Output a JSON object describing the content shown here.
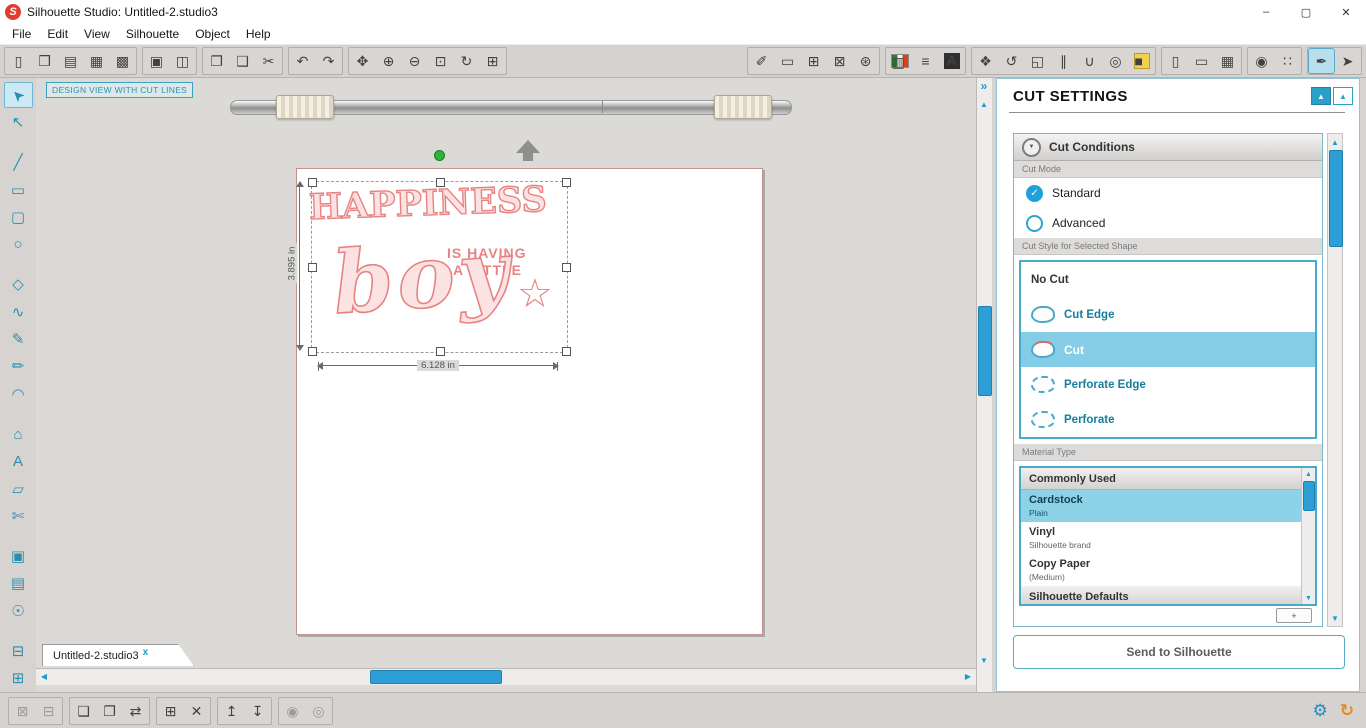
{
  "window": {
    "title": "Silhouette Studio: Untitled-2.studio3"
  },
  "colors": {
    "accent_teal": "#2aa0c8",
    "selection_blue": "#85cde7",
    "material_selected": "#8ed2e8",
    "scroll_thumb": "#2d9fd6",
    "design_pink": "#e88383",
    "logo_red": "#e23c30"
  },
  "icons": {
    "logo": "S",
    "minimize": "–",
    "maximize": "▢",
    "close": "✕",
    "up": "▲",
    "down": "▼",
    "left": "◀",
    "right": "▶",
    "collapse": "»",
    "check": "✓",
    "gear": "⚙",
    "sync": "↻",
    "plus": "+"
  },
  "menu": {
    "items": [
      {
        "name": "menu-file",
        "label": "File"
      },
      {
        "name": "menu-edit",
        "label": "Edit"
      },
      {
        "name": "menu-view",
        "label": "View"
      },
      {
        "name": "menu-silhouette",
        "label": "Silhouette"
      },
      {
        "name": "menu-object",
        "label": "Object"
      },
      {
        "name": "menu-help",
        "label": "Help"
      }
    ]
  },
  "toolbar": {
    "file_group": [
      {
        "name": "new-document-button",
        "icon": "new-document-icon",
        "glyph": "▯"
      },
      {
        "name": "open-document-button",
        "icon": "open-folder-icon",
        "glyph": "❒"
      },
      {
        "name": "open-recent-button",
        "icon": "recent-files-icon",
        "glyph": "▤"
      },
      {
        "name": "save-button",
        "icon": "save-icon",
        "glyph": "▦"
      },
      {
        "name": "save-as-button",
        "icon": "save-as-icon",
        "glyph": "▩"
      }
    ],
    "print_group": [
      {
        "name": "print-button",
        "icon": "printer-icon",
        "glyph": "▣"
      },
      {
        "name": "print-setup-button",
        "icon": "printer-setup-icon",
        "glyph": "◫"
      }
    ],
    "clipboard_group": [
      {
        "name": "copy-button",
        "icon": "copy-icon",
        "glyph": "❐"
      },
      {
        "name": "paste-button",
        "icon": "paste-icon",
        "glyph": "❑"
      },
      {
        "name": "cut-button",
        "icon": "scissors-icon",
        "glyph": "✂"
      }
    ],
    "undo_group": [
      {
        "name": "undo-button",
        "icon": "undo-icon",
        "glyph": "↶"
      },
      {
        "name": "redo-button",
        "icon": "redo-icon",
        "glyph": "↷"
      }
    ],
    "view_group": [
      {
        "name": "pan-button",
        "icon": "pan-icon",
        "glyph": "✥"
      },
      {
        "name": "zoom-in-button",
        "icon": "zoom-in-icon",
        "glyph": "⊕"
      },
      {
        "name": "zoom-out-button",
        "icon": "zoom-out-icon",
        "glyph": "⊖"
      },
      {
        "name": "zoom-selection-button",
        "icon": "zoom-selection-icon",
        "glyph": "⊡"
      },
      {
        "name": "zoom-reset-button",
        "icon": "zoom-reset-icon",
        "glyph": "↻"
      },
      {
        "name": "fit-to-page-button",
        "icon": "fit-to-page-icon",
        "glyph": "⊞"
      }
    ],
    "document_group": [
      {
        "name": "pixscan-button",
        "icon": "pixscan-icon",
        "glyph": "✐"
      },
      {
        "name": "page-settings-button",
        "icon": "page-settings-icon",
        "glyph": "▭"
      },
      {
        "name": "grid-settings-button",
        "icon": "grid-settings-icon",
        "glyph": "⊞"
      },
      {
        "name": "registration-marks-button",
        "icon": "registration-marks-icon",
        "glyph": "⊠"
      },
      {
        "name": "pierce-options-button",
        "icon": "pierce-options-icon",
        "glyph": "⊛"
      }
    ],
    "style_group": [
      {
        "name": "fill-color-button",
        "icon": "fill-color-icon",
        "glyph": "▥"
      },
      {
        "name": "line-style-button",
        "icon": "line-style-icon",
        "glyph": "≡"
      },
      {
        "name": "text-style-button",
        "icon": "text-style-icon",
        "glyph": "A"
      }
    ],
    "object_group": [
      {
        "name": "replicate-button",
        "icon": "replicate-icon",
        "glyph": "❖"
      },
      {
        "name": "rotate-options-button",
        "icon": "rotate-options-icon",
        "glyph": "↺"
      },
      {
        "name": "scale-options-button",
        "icon": "scale-options-icon",
        "glyph": "◱"
      },
      {
        "name": "align-options-button",
        "icon": "align-options-icon",
        "glyph": "∥"
      },
      {
        "name": "weld-options-button",
        "icon": "weld-options-icon",
        "glyph": "∪"
      },
      {
        "name": "offset-options-button",
        "icon": "offset-options-icon",
        "glyph": "◎"
      },
      {
        "name": "trace-options-button",
        "icon": "trace-options-icon",
        "glyph": "■"
      }
    ],
    "device_group": [
      {
        "name": "mobile-devices-button",
        "icon": "mobile-device-icon",
        "glyph": "▯"
      },
      {
        "name": "tablet-devices-button",
        "icon": "tablet-device-icon",
        "glyph": "▭"
      },
      {
        "name": "library-view-button",
        "icon": "library-grid-icon",
        "glyph": "▦"
      }
    ],
    "preview_group": [
      {
        "name": "camera-preview-button",
        "icon": "camera-preview-icon",
        "glyph": "◉"
      },
      {
        "name": "pattern-view-button",
        "icon": "pattern-view-icon",
        "glyph": "∷"
      }
    ],
    "panel_group": [
      {
        "name": "cut-settings-button",
        "icon": "cut-settings-icon",
        "glyph": "✒",
        "state": "active"
      },
      {
        "name": "send-to-silhouette-button",
        "icon": "send-to-silhouette-icon",
        "glyph": "➤"
      }
    ]
  },
  "tools": {
    "items": [
      {
        "name": "select-tool",
        "icon": "select-tool-icon",
        "glyph": "➤",
        "state": "active"
      },
      {
        "name": "point-editing-tool",
        "icon": "point-editing-icon",
        "glyph": "↖"
      },
      {
        "gap": true
      },
      {
        "name": "line-tool",
        "icon": "line-tool-icon",
        "glyph": "╱"
      },
      {
        "name": "rectangle-tool",
        "icon": "rectangle-tool-icon",
        "glyph": "▭"
      },
      {
        "name": "rounded-rectangle-tool",
        "icon": "rounded-rectangle-icon",
        "glyph": "▢"
      },
      {
        "name": "ellipse-tool",
        "icon": "ellipse-tool-icon",
        "glyph": "○"
      },
      {
        "gap": true
      },
      {
        "name": "polygon-tool",
        "icon": "polygon-tool-icon",
        "glyph": "◇"
      },
      {
        "name": "curve-tool",
        "icon": "curve-tool-icon",
        "glyph": "∿"
      },
      {
        "name": "freehand-tool",
        "icon": "freehand-tool-icon",
        "glyph": "✎"
      },
      {
        "name": "smooth-freehand-tool",
        "icon": "smooth-freehand-icon",
        "glyph": "✏"
      },
      {
        "name": "arc-tool",
        "icon": "arc-tool-icon",
        "glyph": "◠"
      },
      {
        "gap": true
      },
      {
        "name": "regular-polygon-tool",
        "icon": "regular-polygon-icon",
        "glyph": "⌂"
      },
      {
        "name": "text-tool",
        "icon": "text-tool-icon",
        "glyph": "A"
      },
      {
        "name": "eraser-tool",
        "icon": "eraser-tool-icon",
        "glyph": "▱"
      },
      {
        "name": "knife-tool",
        "icon": "knife-tool-icon",
        "glyph": "✄"
      },
      {
        "gap": true
      },
      {
        "name": "page-setup-panel-button",
        "icon": "page-setup-panel-icon",
        "glyph": "▣"
      },
      {
        "name": "sketch-panel-button",
        "icon": "sketch-panel-icon",
        "glyph": "▤"
      },
      {
        "name": "design-store-button",
        "icon": "design-store-icon",
        "glyph": "☉"
      },
      {
        "gap": true
      },
      {
        "name": "layers-panel-button",
        "icon": "layers-panel-icon",
        "glyph": "⊟"
      },
      {
        "name": "library-panel-button",
        "icon": "library-panel-icon",
        "glyph": "⊞"
      }
    ]
  },
  "bottom": {
    "transform_group": [
      {
        "name": "transform-options-button",
        "icon": "transform-options-icon",
        "glyph": "⊠",
        "state": "disabled"
      },
      {
        "name": "resize-options-button",
        "icon": "resize-options-icon",
        "glyph": "⊟",
        "state": "disabled"
      }
    ],
    "duplicate_group": [
      {
        "name": "copy-instance-button",
        "icon": "copy-instance-icon",
        "glyph": "❏"
      },
      {
        "name": "duplicate-button",
        "icon": "duplicate-icon",
        "glyph": "❐"
      },
      {
        "name": "mirror-button",
        "icon": "mirror-icon",
        "glyph": "⇄"
      }
    ],
    "group_group": [
      {
        "name": "group-button",
        "icon": "group-icon",
        "glyph": "⊞"
      },
      {
        "name": "ungroup-button",
        "icon": "ungroup-icon",
        "glyph": "✕"
      }
    ],
    "order_group": [
      {
        "name": "bring-to-front-button",
        "icon": "bring-to-front-icon",
        "glyph": "↥"
      },
      {
        "name": "send-to-back-button",
        "icon": "send-to-back-icon",
        "glyph": "↧"
      }
    ],
    "modify_group": [
      {
        "name": "lock-button",
        "icon": "lock-icon",
        "glyph": "◉",
        "state": "disabled"
      },
      {
        "name": "offset-button",
        "icon": "offset-icon",
        "glyph": "◎",
        "state": "disabled"
      }
    ]
  },
  "canvas": {
    "badge": "DESIGN VIEW WITH CUT LINES",
    "design": {
      "headline": "HAPPINESS",
      "line2": "IS HAVING",
      "line3": "A LITTLE",
      "script": "boy",
      "star": "☆",
      "color": "#e88383"
    },
    "dims": {
      "height": "3.895 in",
      "width": "6.128 in"
    },
    "tab": {
      "label": "Untitled-2.studio3",
      "close": "x"
    }
  },
  "cut_panel": {
    "title": "CUT SETTINGS",
    "conditions_header": "Cut Conditions",
    "cut_mode_label": "Cut Mode",
    "modes": [
      {
        "label": "Standard",
        "selected": true
      },
      {
        "label": "Advanced",
        "selected": false
      }
    ],
    "style_header": "Cut Style for Selected Shape",
    "styles": [
      {
        "label": "No Cut",
        "selected": false
      },
      {
        "label": "Cut Edge",
        "selected": false
      },
      {
        "label": "Cut",
        "selected": true
      },
      {
        "label": "Perforate Edge",
        "selected": false
      },
      {
        "label": "Perforate",
        "selected": false
      }
    ],
    "material_header": "Material Type",
    "material_groups": {
      "commonly_used": "Commonly Used",
      "defaults": "Silhouette Defaults"
    },
    "materials": [
      {
        "name": "Cardstock",
        "sub": "Plain",
        "selected": true
      },
      {
        "name": "Vinyl",
        "sub": "Silhouette brand",
        "selected": false
      },
      {
        "name": "Copy Paper",
        "sub": "(Medium)",
        "selected": false
      }
    ],
    "send_button": "Send to Silhouette"
  }
}
